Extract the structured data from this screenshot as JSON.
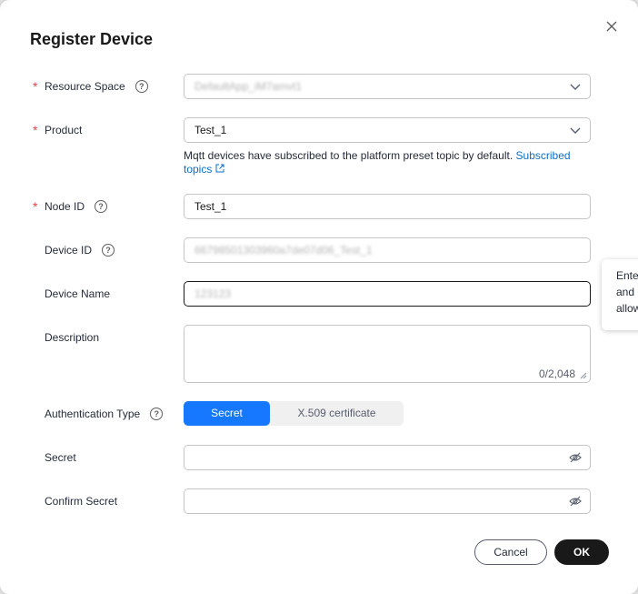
{
  "dialog": {
    "title": "Register Device",
    "close_icon": "close-icon"
  },
  "form": {
    "resource_space": {
      "label": "Resource Space",
      "required": true,
      "value": "DefaultApp_iM7amvt1"
    },
    "product": {
      "label": "Product",
      "required": true,
      "value": "Test_1"
    },
    "product_hint": {
      "text": "Mqtt devices have subscribed to the platform preset topic by default.",
      "link": "Subscribed topics"
    },
    "node_id": {
      "label": "Node ID",
      "required": true,
      "value": "Test_1"
    },
    "device_id": {
      "label": "Device ID",
      "value": "66798501303960a7de07d06_Test_1"
    },
    "device_name": {
      "label": "Device Name",
      "value": "123123"
    },
    "description": {
      "label": "Description",
      "counter": "0/2,048"
    },
    "auth_type": {
      "label": "Authentication Type",
      "options": [
        "Secret",
        "X.509 certificate"
      ],
      "selected": "Secret"
    },
    "secret": {
      "label": "Secret",
      "value": ""
    },
    "confirm_secret": {
      "label": "Confirm Secret",
      "value": ""
    }
  },
  "tooltip": {
    "lines": [
      "Ente",
      "and",
      "allow"
    ]
  },
  "footer": {
    "cancel_label": "Cancel",
    "ok_label": "OK"
  },
  "colors": {
    "primary": "#1677ff",
    "required": "#e54545",
    "link": "#0d6fc8",
    "ok_button": "#191919"
  }
}
